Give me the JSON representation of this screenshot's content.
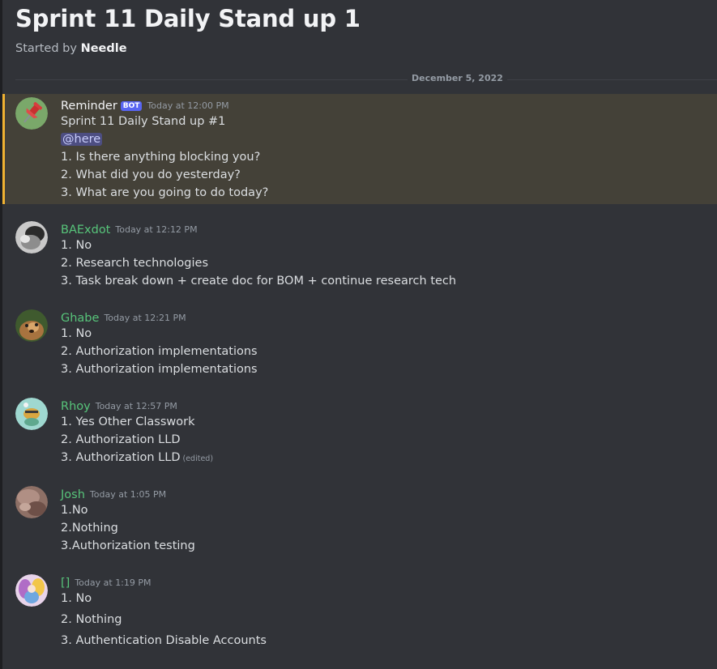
{
  "thread": {
    "title": "Sprint 11 Daily Stand up 1",
    "started_by_prefix": "Started by ",
    "started_by_name": "Needle"
  },
  "divider": {
    "date": "December 5, 2022"
  },
  "messages": [
    {
      "username": "Reminder",
      "bot_tag": "BOT",
      "timestamp": "Today at 12:00 PM",
      "lines": [
        "Sprint 11 Daily Stand up #1",
        "@here",
        "1. Is there anything blocking you?",
        "2. What did you do yesterday?",
        "3. What are you going to do today?"
      ]
    },
    {
      "username": "BAExdot",
      "timestamp": "Today at 12:12 PM",
      "lines": [
        "1. No",
        "2. Research technologies",
        "3. Task break down + create doc for BOM + continue research tech"
      ]
    },
    {
      "username": "Ghabe",
      "timestamp": "Today at 12:21 PM",
      "lines": [
        "1. No",
        "2. Authorization implementations",
        "3. Authorization implementations"
      ]
    },
    {
      "username": "Rhoy",
      "timestamp": "Today at 12:57 PM",
      "lines": [
        "1. Yes Other Classwork",
        "2. Authorization LLD",
        "3. Authorization LLD"
      ],
      "edited_label": "(edited)"
    },
    {
      "username": "Josh",
      "timestamp": "Today at 1:05 PM",
      "lines": [
        "1.No",
        "2.Nothing",
        "3.Authorization testing"
      ]
    },
    {
      "username": "[]",
      "timestamp": "Today at 1:19 PM",
      "lines": [
        "1. No",
        "2. Nothing",
        "3. Authentication Disable Accounts"
      ]
    }
  ],
  "colors": {
    "background": "#313338",
    "mention_highlight": "#444138",
    "mention_bar": "#f0b232",
    "member_name": "#57c47a",
    "bot_tag": "#5865f2"
  }
}
